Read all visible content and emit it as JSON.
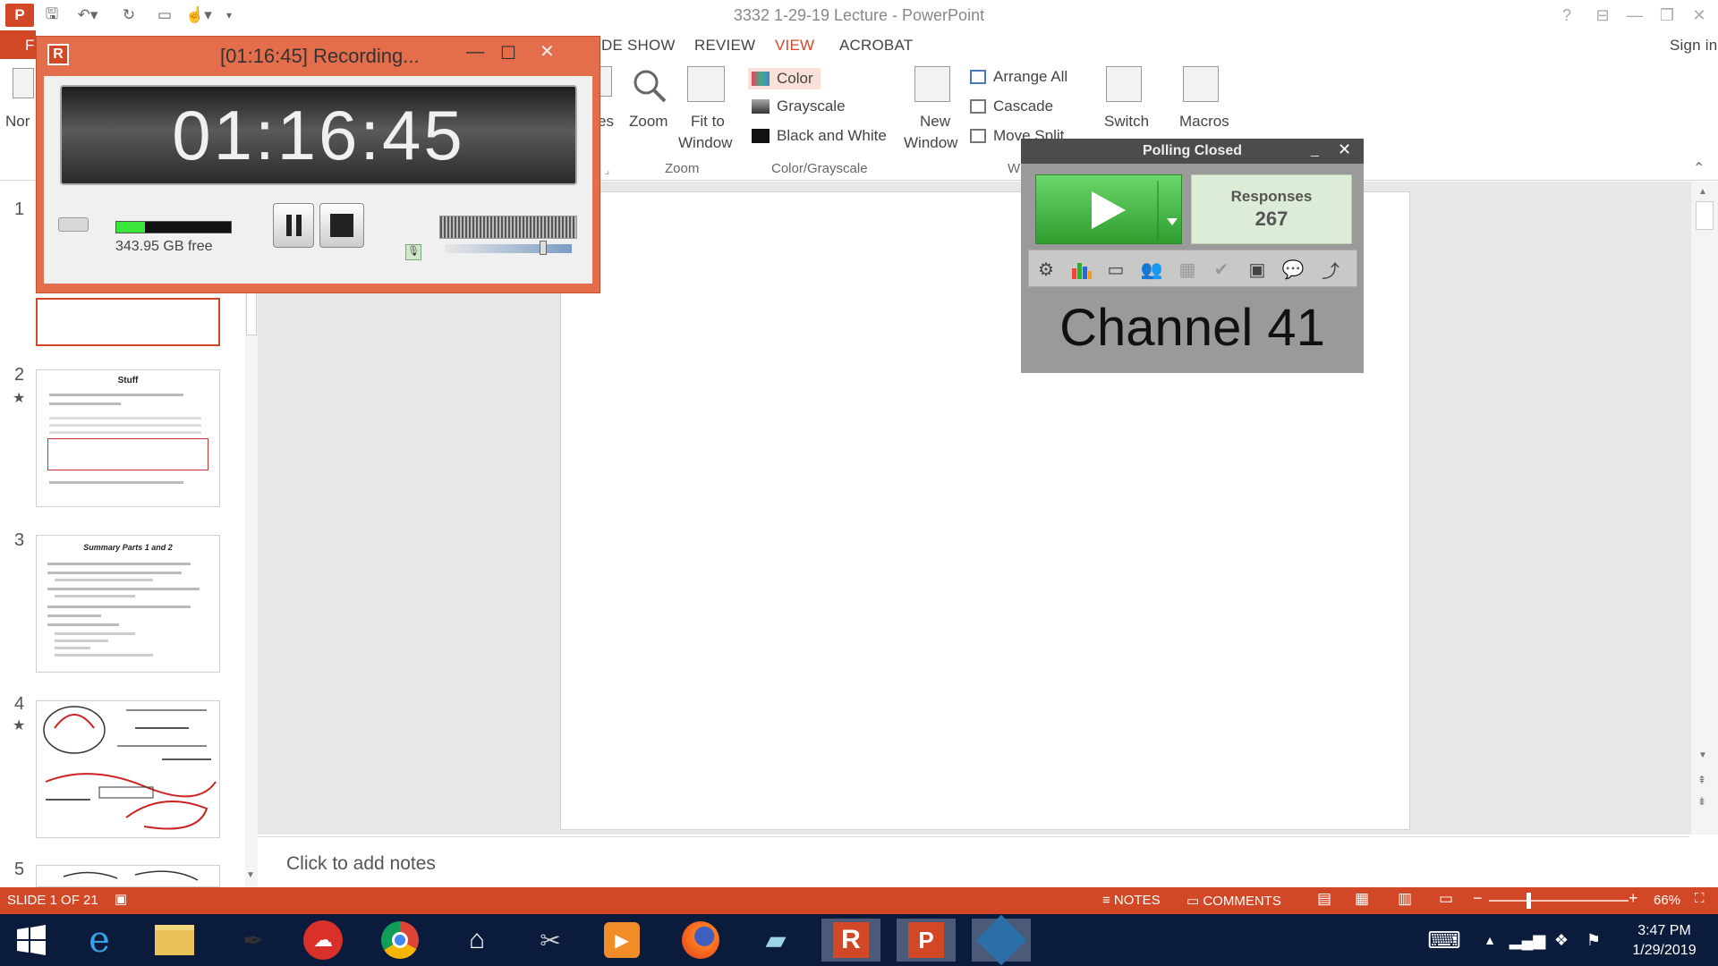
{
  "window_title": "3332 1-29-19 Lecture - PowerPoint",
  "title_buttons": {
    "help": "?",
    "restore_ribbon": "⊟",
    "min": "—",
    "max": "❐",
    "close": "✕"
  },
  "tabs": [
    {
      "label": "F"
    },
    {
      "label": "DE SHOW"
    },
    {
      "label": "REVIEW"
    },
    {
      "label": "VIEW"
    },
    {
      "label": "ACROBAT"
    }
  ],
  "sign_in": "Sign in",
  "ribbon": {
    "normal_partial": "Nor",
    "notes_partial": "es",
    "zoom": "Zoom",
    "fit_line1": "Fit to",
    "fit_line2": "Window",
    "zoom_group": "Zoom",
    "color": "Color",
    "grayscale": "Grayscale",
    "bw": "Black and White",
    "color_group": "Color/Grayscale",
    "new_line1": "New",
    "new_line2": "Window",
    "arrange_all": "Arrange All",
    "cascade": "Cascade",
    "move_split": "Move Split",
    "window_group_partial": "W",
    "switch_line1": "Switch",
    "macros": "Macros"
  },
  "recorder": {
    "title": "[01:16:45] Recording...",
    "time": "01:16:45",
    "disk_free": "343.95 GB free",
    "level": 0.25
  },
  "polling": {
    "title": "Polling Closed",
    "responses_label": "Responses",
    "responses_count": "267",
    "channel": "Channel 41"
  },
  "slides": [
    {
      "number": "1",
      "title": ""
    },
    {
      "number": "2",
      "title": "Stuff",
      "starred": true
    },
    {
      "number": "3",
      "title": "Summary Parts 1 and 2"
    },
    {
      "number": "4",
      "starred": true
    },
    {
      "number": "5"
    }
  ],
  "notes_placeholder": "Click to add notes",
  "status": {
    "slide_info": "SLIDE 1 OF 21",
    "notes": "NOTES",
    "comments": "COMMENTS",
    "zoom": "66%"
  },
  "clock": {
    "time": "3:47 PM",
    "date": "1/29/2019"
  },
  "colors": {
    "accent": "#D24726",
    "recorder": "#E46D4B",
    "taskbar": "#0B1B3B",
    "play_green": "#3BAA3B"
  }
}
